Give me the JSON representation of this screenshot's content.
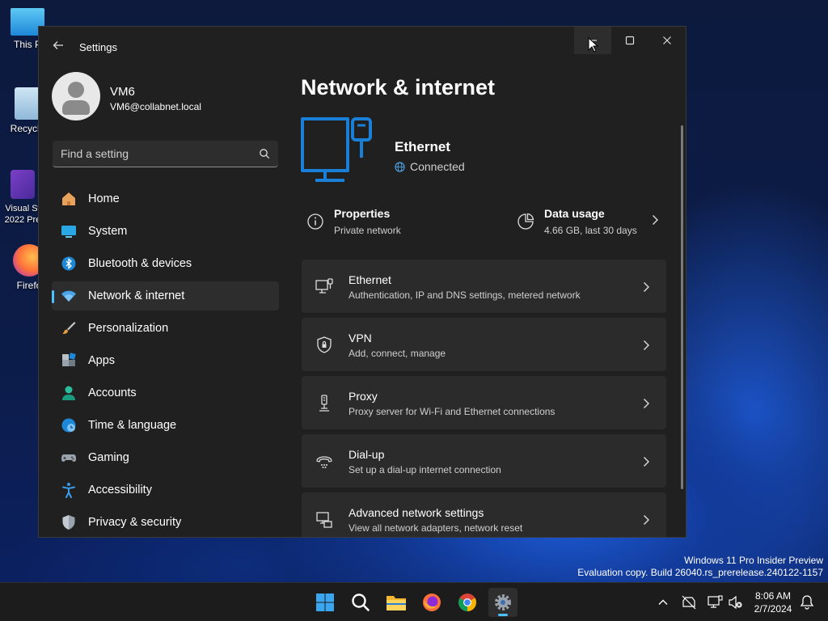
{
  "desktop": {
    "icons": [
      {
        "label": "This P"
      },
      {
        "label": "Recycle"
      },
      {
        "label": "Visual St 2022 Pre"
      },
      {
        "label": "Firefo"
      }
    ],
    "watermark": {
      "line1": "Windows 11 Pro Insider Preview",
      "line2": "Evaluation copy. Build 26040.rs_prerelease.240122-1157"
    }
  },
  "window": {
    "title": "Settings",
    "controls": {
      "minimize": "minimize",
      "maximize": "maximize",
      "close": "close"
    }
  },
  "profile": {
    "name": "VM6",
    "email": "VM6@collabnet.local"
  },
  "search": {
    "placeholder": "Find a setting"
  },
  "sidebar": {
    "items": [
      {
        "label": "Home",
        "icon": "home-icon",
        "active": false
      },
      {
        "label": "System",
        "icon": "system-icon",
        "active": false
      },
      {
        "label": "Bluetooth & devices",
        "icon": "bluetooth-icon",
        "active": false
      },
      {
        "label": "Network & internet",
        "icon": "wifi-icon",
        "active": true
      },
      {
        "label": "Personalization",
        "icon": "brush-icon",
        "active": false
      },
      {
        "label": "Apps",
        "icon": "apps-icon",
        "active": false
      },
      {
        "label": "Accounts",
        "icon": "accounts-icon",
        "active": false
      },
      {
        "label": "Time & language",
        "icon": "globe-clock-icon",
        "active": false
      },
      {
        "label": "Gaming",
        "icon": "gamepad-icon",
        "active": false
      },
      {
        "label": "Accessibility",
        "icon": "accessibility-icon",
        "active": false
      },
      {
        "label": "Privacy & security",
        "icon": "shield-icon",
        "active": false
      }
    ]
  },
  "main": {
    "title": "Network & internet",
    "hero": {
      "name": "Ethernet",
      "status": "Connected"
    },
    "properties": {
      "label": "Properties",
      "sub": "Private network"
    },
    "data_usage": {
      "label": "Data usage",
      "sub": "4.66 GB, last 30 days"
    },
    "rows": [
      {
        "label": "Ethernet",
        "sub": "Authentication, IP and DNS settings, metered network",
        "icon": "ethernet-icon"
      },
      {
        "label": "VPN",
        "sub": "Add, connect, manage",
        "icon": "vpn-shield-icon"
      },
      {
        "label": "Proxy",
        "sub": "Proxy server for Wi-Fi and Ethernet connections",
        "icon": "proxy-icon"
      },
      {
        "label": "Dial-up",
        "sub": "Set up a dial-up internet connection",
        "icon": "dialup-icon"
      },
      {
        "label": "Advanced network settings",
        "sub": "View all network adapters, network reset",
        "icon": "advanced-network-icon"
      }
    ]
  },
  "taskbar": {
    "clock_time": "8:06 AM",
    "clock_date": "2/7/2024"
  },
  "colors": {
    "accent": "#4cc2ff",
    "window_bg": "#202020",
    "card_bg": "#2b2b2b",
    "hero_blue": "#1a7fd6"
  }
}
